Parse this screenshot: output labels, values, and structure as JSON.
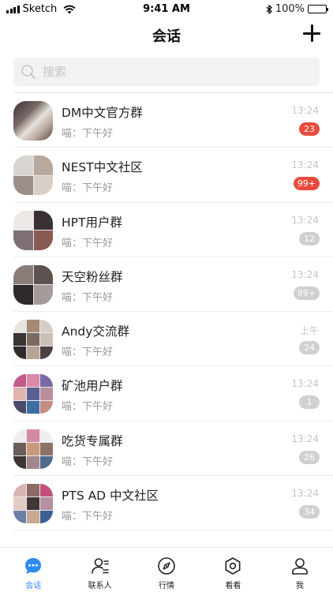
{
  "status_bar": {
    "carrier": "Sketch",
    "time": "9:41 AM",
    "battery": "100%"
  },
  "nav": {
    "title": "会话",
    "add_icon": "plus-icon"
  },
  "search": {
    "placeholder": "搜索"
  },
  "chats": [
    {
      "name": "DM中文官方群",
      "preview": "喵：下午好",
      "time": "13:24",
      "badge": "23",
      "badge_style": "red"
    },
    {
      "name": "NEST中文社区",
      "preview": "喵：下午好",
      "time": "13:24",
      "badge": "99+",
      "badge_style": "red"
    },
    {
      "name": "HPT用户群",
      "preview": "喵：下午好",
      "time": "13:24",
      "badge": "12",
      "badge_style": "grey"
    },
    {
      "name": "天空粉丝群",
      "preview": "喵：下午好",
      "time": "13:24",
      "badge": "99+",
      "badge_style": "grey"
    },
    {
      "name": "Andy交流群",
      "preview": "喵：下午好",
      "time": "上午",
      "badge": "24",
      "badge_style": "grey"
    },
    {
      "name": "矿池用户群",
      "preview": "喵：下午好",
      "time": "13:24",
      "badge": "1",
      "badge_style": "grey"
    },
    {
      "name": "吃货专属群",
      "preview": "喵：下午好",
      "time": "13:24",
      "badge": "26",
      "badge_style": "grey"
    },
    {
      "name": "PTS AD 中文社区",
      "preview": "喵：下午好",
      "time": "13:24",
      "badge": "34",
      "badge_style": "grey"
    }
  ],
  "tabs": [
    {
      "label": "会话",
      "icon": "chat-bubble-icon",
      "active": true
    },
    {
      "label": "联系人",
      "icon": "contacts-icon",
      "active": false
    },
    {
      "label": "行情",
      "icon": "compass-icon",
      "active": false
    },
    {
      "label": "看看",
      "icon": "hexagon-icon",
      "active": false
    },
    {
      "label": "我",
      "icon": "person-icon",
      "active": false
    }
  ],
  "colors": {
    "accent": "#2d8cf0",
    "badge_red": "#e84a3d",
    "badge_grey": "#d0d0d0"
  }
}
